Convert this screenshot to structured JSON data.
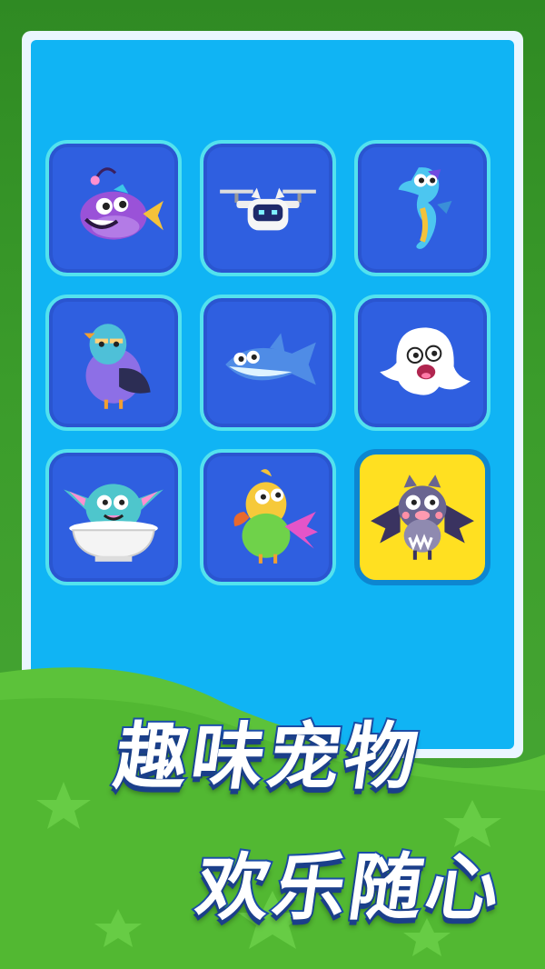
{
  "slogan": {
    "line1": "趣味宠物",
    "line2": "欢乐随心"
  },
  "pets": [
    {
      "icon": "anglerfish-icon",
      "selected": false
    },
    {
      "icon": "drone-robot-icon",
      "selected": false
    },
    {
      "icon": "seahorse-icon",
      "selected": false
    },
    {
      "icon": "pigeon-icon",
      "selected": false
    },
    {
      "icon": "shark-icon",
      "selected": false
    },
    {
      "icon": "ghost-icon",
      "selected": false
    },
    {
      "icon": "furry-in-bathtub-icon",
      "selected": false
    },
    {
      "icon": "parrot-icon",
      "selected": false
    },
    {
      "icon": "bat-icon",
      "selected": true
    }
  ],
  "colors": {
    "panel": "#10b4f4",
    "tile": "#2f5fe0",
    "tile_border": "#53e2ee",
    "selected_tile": "#ffe021",
    "grass": "#5cc23a"
  }
}
